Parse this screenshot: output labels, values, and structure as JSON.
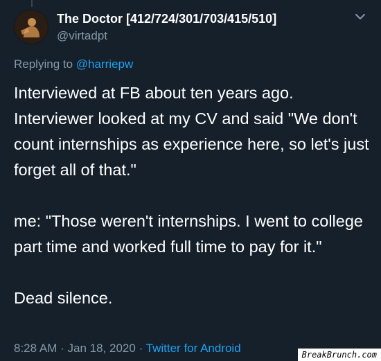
{
  "tweet": {
    "author": {
      "display_name": "The Doctor [412/724/301/703/415/510]",
      "handle": "@virtadpt"
    },
    "replying": {
      "prefix": "Replying to",
      "to_handle": "@harriepw"
    },
    "paragraphs": [
      "Interviewed at FB about ten years ago. Interviewer looked at my CV and said \"We don't count internships as experience here, so let's just forget all of that.\"",
      "me: \"Those weren't internships. I went to college part time and worked full time to pay for it.\"",
      "Dead silence."
    ],
    "time": "8:28 AM",
    "separator": "·",
    "date": "Jan 18, 2020",
    "source": "Twitter for Android",
    "menu_icon": "chevron-down-icon",
    "avatar_icon": "avatar"
  },
  "watermark": {
    "text": "BreakBrunch.com"
  },
  "colors": {
    "background": "#15202b",
    "text": "#ffffff",
    "muted": "#8899a6",
    "link": "#1da1f2"
  }
}
